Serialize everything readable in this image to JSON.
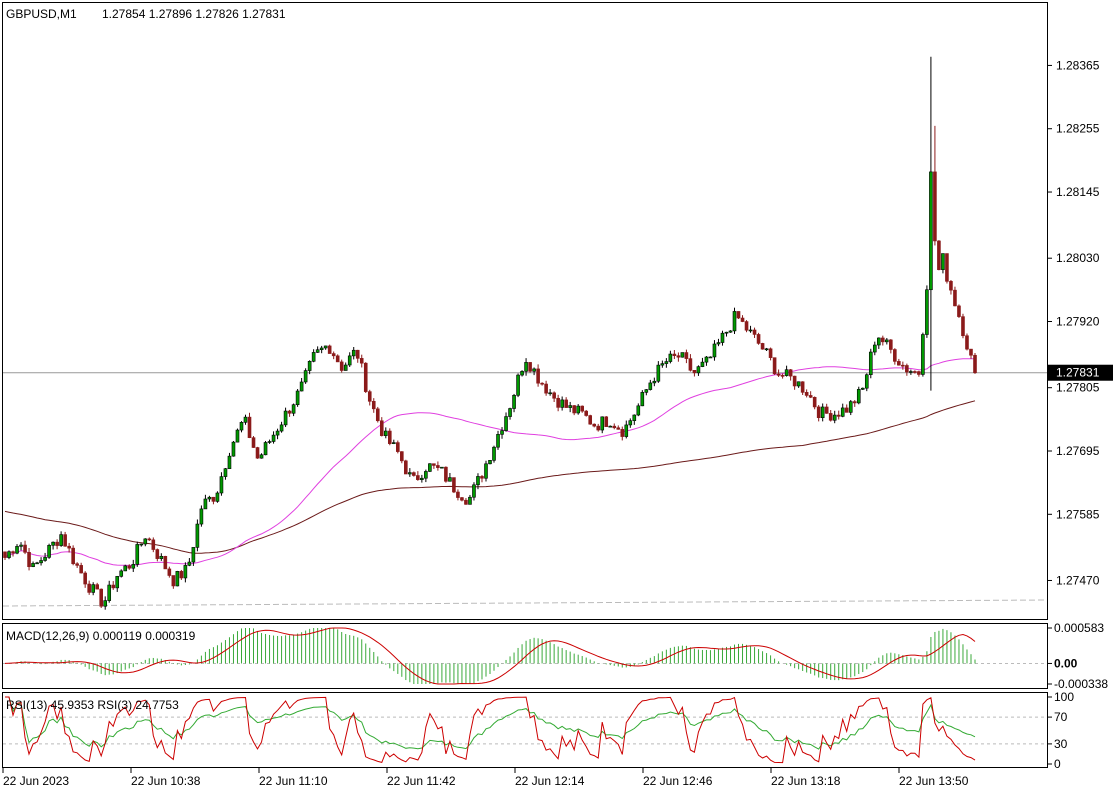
{
  "main": {
    "symbol": "GBPUSD,M1",
    "ohlc": "1.27854 1.27896 1.27826 1.27831",
    "current_price": "1.27831",
    "price_labels": [
      "1.28365",
      "1.28255",
      "1.28145",
      "1.28030",
      "1.27920",
      "1.27805",
      "1.27695",
      "1.27585",
      "1.27470"
    ],
    "price_min": 1.2741,
    "price_max": 1.2847
  },
  "macd": {
    "label": "MACD(12,26,9) 0.000119 0.000319",
    "scale_labels": [
      "0.000583",
      "0.00",
      "-0.000338"
    ]
  },
  "rsi": {
    "label": "RSI(13) 45.9353  RSI(3) 24.7753",
    "scale_labels": [
      "100",
      "70",
      "30",
      "0"
    ]
  },
  "time_axis": [
    "22 Jun 2023",
    "22 Jun 10:38",
    "22 Jun 11:10",
    "22 Jun 11:42",
    "22 Jun 12:14",
    "22 Jun 12:46",
    "22 Jun 13:18",
    "22 Jun 13:50"
  ],
  "colors": {
    "bull": "#000000",
    "bear": "#8b1a1a",
    "body_bull": "#009900",
    "body_bear": "#8b1a1a",
    "ma_fast": "#e040e0",
    "ma_slow": "#6b1a1a",
    "macd_hist": "#3aa93a",
    "macd_signal": "#cc0000",
    "rsi_slow": "#33aa33",
    "rsi_fast": "#cc0000"
  },
  "chart_data": {
    "type": "candlestick",
    "title": "GBPUSD,M1",
    "close_path": [
      1.2751,
      1.2754,
      1.2749,
      1.2752,
      1.2755,
      1.275,
      1.2746,
      1.2743,
      1.2748,
      1.275,
      1.2755,
      1.2751,
      1.2747,
      1.2749,
      1.276,
      1.2762,
      1.277,
      1.2775,
      1.2768,
      1.2772,
      1.2776,
      1.278,
      1.2786,
      1.2788,
      1.2784,
      1.2787,
      1.2778,
      1.2772,
      1.2769,
      1.2764,
      1.2767,
      1.2766,
      1.2763,
      1.2761,
      1.2766,
      1.2772,
      1.2778,
      1.2786,
      1.2782,
      1.2779,
      1.2777,
      1.2776,
      1.2774,
      1.2775,
      1.2773,
      1.2777,
      1.2782,
      1.2785,
      1.2786,
      1.2783,
      1.2785,
      1.2789,
      1.2793,
      1.279,
      1.2787,
      1.2783,
      1.2782,
      1.278,
      1.2776,
      1.2776,
      1.2777,
      1.278,
      1.279,
      1.2787,
      1.2784,
      1.2783,
      1.281,
      1.28,
      1.2792,
      1.2783
    ]
  }
}
